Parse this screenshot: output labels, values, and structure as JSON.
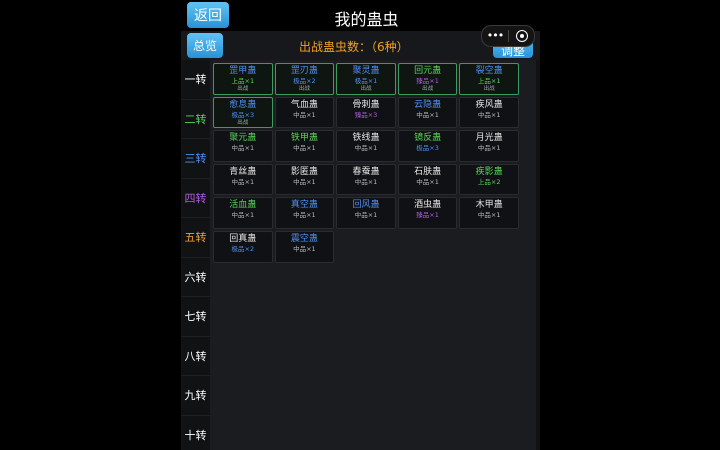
{
  "header": {
    "back_label": "返回",
    "title": "我的蛊虫"
  },
  "subheader": {
    "overview_label": "总览",
    "count_text": "出战蛊虫数：（6种）",
    "adjust_label": "调整"
  },
  "capsule": {
    "dots": "•••",
    "icons": [
      "more-dots-icon",
      "target-icon"
    ]
  },
  "tiers": [
    {
      "label": "一转",
      "color": "#ffffff"
    },
    {
      "label": "二转",
      "color": "#5ad35a"
    },
    {
      "label": "三转",
      "color": "#4f8ff0"
    },
    {
      "label": "四转",
      "color": "#b05ae8"
    },
    {
      "label": "五转",
      "color": "#f0a030"
    },
    {
      "label": "六转",
      "color": "#ffffff"
    },
    {
      "label": "七转",
      "color": "#ffffff"
    },
    {
      "label": "八转",
      "color": "#ffffff"
    },
    {
      "label": "九转",
      "color": "#ffffff"
    },
    {
      "label": "十转",
      "color": "#ffffff"
    }
  ],
  "colors": {
    "white": "#e6e6e6",
    "green": "#5ad35a",
    "blue": "#4f8ff0",
    "purple": "#b05ae8",
    "gray": "#b8b8b8"
  },
  "gu": [
    {
      "name": "罡甲蛊",
      "grade": "上品×1",
      "status": "出战",
      "name_color": "#4f8ff0",
      "grade_color": "#5ad35a",
      "active": true
    },
    {
      "name": "罡刃蛊",
      "grade": "极品×2",
      "status": "出战",
      "name_color": "#4f8ff0",
      "grade_color": "#4f8ff0",
      "active": true
    },
    {
      "name": "聚灵蛊",
      "grade": "极品×1",
      "status": "出战",
      "name_color": "#4f8ff0",
      "grade_color": "#4f8ff0",
      "active": true
    },
    {
      "name": "回元蛊",
      "grade": "臻品×1",
      "status": "出战",
      "name_color": "#5ad35a",
      "grade_color": "#b05ae8",
      "active": true
    },
    {
      "name": "裂空蛊",
      "grade": "上品×1",
      "status": "出战",
      "name_color": "#4f8ff0",
      "grade_color": "#5ad35a",
      "active": true
    },
    {
      "name": "愈息蛊",
      "grade": "极品×3",
      "status": "出战",
      "name_color": "#4f8ff0",
      "grade_color": "#4f8ff0",
      "active": true
    },
    {
      "name": "气血蛊",
      "grade": "中品×1",
      "status": "",
      "name_color": "#e6e6e6",
      "grade_color": "#b8b8b8",
      "active": false
    },
    {
      "name": "骨刺蛊",
      "grade": "臻品×3",
      "status": "",
      "name_color": "#e6e6e6",
      "grade_color": "#b05ae8",
      "active": false
    },
    {
      "name": "云隐蛊",
      "grade": "中品×1",
      "status": "",
      "name_color": "#4f8ff0",
      "grade_color": "#b8b8b8",
      "active": false
    },
    {
      "name": "疾风蛊",
      "grade": "中品×1",
      "status": "",
      "name_color": "#e6e6e6",
      "grade_color": "#b8b8b8",
      "active": false
    },
    {
      "name": "聚元蛊",
      "grade": "中品×1",
      "status": "",
      "name_color": "#5ad35a",
      "grade_color": "#b8b8b8",
      "active": false
    },
    {
      "name": "铁甲蛊",
      "grade": "中品×1",
      "status": "",
      "name_color": "#5ad35a",
      "grade_color": "#b8b8b8",
      "active": false
    },
    {
      "name": "铁线蛊",
      "grade": "中品×1",
      "status": "",
      "name_color": "#e6e6e6",
      "grade_color": "#b8b8b8",
      "active": false
    },
    {
      "name": "镜反蛊",
      "grade": "极品×3",
      "status": "",
      "name_color": "#5ad35a",
      "grade_color": "#4f8ff0",
      "active": false
    },
    {
      "name": "月光蛊",
      "grade": "中品×1",
      "status": "",
      "name_color": "#e6e6e6",
      "grade_color": "#b8b8b8",
      "active": false
    },
    {
      "name": "青丝蛊",
      "grade": "中品×1",
      "status": "",
      "name_color": "#e6e6e6",
      "grade_color": "#b8b8b8",
      "active": false
    },
    {
      "name": "影匿蛊",
      "grade": "中品×1",
      "status": "",
      "name_color": "#e6e6e6",
      "grade_color": "#b8b8b8",
      "active": false
    },
    {
      "name": "春蚕蛊",
      "grade": "中品×1",
      "status": "",
      "name_color": "#e6e6e6",
      "grade_color": "#b8b8b8",
      "active": false
    },
    {
      "name": "石肤蛊",
      "grade": "中品×1",
      "status": "",
      "name_color": "#e6e6e6",
      "grade_color": "#b8b8b8",
      "active": false
    },
    {
      "name": "疾影蛊",
      "grade": "上品×2",
      "status": "",
      "name_color": "#5ad35a",
      "grade_color": "#5ad35a",
      "active": false
    },
    {
      "name": "活血蛊",
      "grade": "中品×1",
      "status": "",
      "name_color": "#5ad35a",
      "grade_color": "#b8b8b8",
      "active": false
    },
    {
      "name": "真空蛊",
      "grade": "中品×1",
      "status": "",
      "name_color": "#4f8ff0",
      "grade_color": "#b8b8b8",
      "active": false
    },
    {
      "name": "回风蛊",
      "grade": "中品×1",
      "status": "",
      "name_color": "#4f8ff0",
      "grade_color": "#b8b8b8",
      "active": false
    },
    {
      "name": "酒虫蛊",
      "grade": "臻品×1",
      "status": "",
      "name_color": "#e6e6e6",
      "grade_color": "#b05ae8",
      "active": false
    },
    {
      "name": "木甲蛊",
      "grade": "中品×1",
      "status": "",
      "name_color": "#e6e6e6",
      "grade_color": "#b8b8b8",
      "active": false
    },
    {
      "name": "回真蛊",
      "grade": "极品×2",
      "status": "",
      "name_color": "#e6e6e6",
      "grade_color": "#4f8ff0",
      "active": false
    },
    {
      "name": "震空蛊",
      "grade": "中品×1",
      "status": "",
      "name_color": "#4f8ff0",
      "grade_color": "#b8b8b8",
      "active": false
    }
  ]
}
